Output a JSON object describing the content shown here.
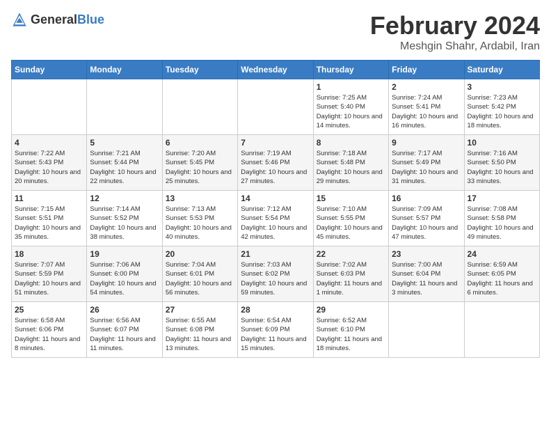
{
  "header": {
    "logo_general": "General",
    "logo_blue": "Blue",
    "title": "February 2024",
    "subtitle": "Meshgin Shahr, Ardabil, Iran"
  },
  "calendar": {
    "weekdays": [
      "Sunday",
      "Monday",
      "Tuesday",
      "Wednesday",
      "Thursday",
      "Friday",
      "Saturday"
    ],
    "weeks": [
      [
        {
          "day": "",
          "info": ""
        },
        {
          "day": "",
          "info": ""
        },
        {
          "day": "",
          "info": ""
        },
        {
          "day": "",
          "info": ""
        },
        {
          "day": "1",
          "info": "Sunrise: 7:25 AM\nSunset: 5:40 PM\nDaylight: 10 hours\nand 14 minutes."
        },
        {
          "day": "2",
          "info": "Sunrise: 7:24 AM\nSunset: 5:41 PM\nDaylight: 10 hours\nand 16 minutes."
        },
        {
          "day": "3",
          "info": "Sunrise: 7:23 AM\nSunset: 5:42 PM\nDaylight: 10 hours\nand 18 minutes."
        }
      ],
      [
        {
          "day": "4",
          "info": "Sunrise: 7:22 AM\nSunset: 5:43 PM\nDaylight: 10 hours\nand 20 minutes."
        },
        {
          "day": "5",
          "info": "Sunrise: 7:21 AM\nSunset: 5:44 PM\nDaylight: 10 hours\nand 22 minutes."
        },
        {
          "day": "6",
          "info": "Sunrise: 7:20 AM\nSunset: 5:45 PM\nDaylight: 10 hours\nand 25 minutes."
        },
        {
          "day": "7",
          "info": "Sunrise: 7:19 AM\nSunset: 5:46 PM\nDaylight: 10 hours\nand 27 minutes."
        },
        {
          "day": "8",
          "info": "Sunrise: 7:18 AM\nSunset: 5:48 PM\nDaylight: 10 hours\nand 29 minutes."
        },
        {
          "day": "9",
          "info": "Sunrise: 7:17 AM\nSunset: 5:49 PM\nDaylight: 10 hours\nand 31 minutes."
        },
        {
          "day": "10",
          "info": "Sunrise: 7:16 AM\nSunset: 5:50 PM\nDaylight: 10 hours\nand 33 minutes."
        }
      ],
      [
        {
          "day": "11",
          "info": "Sunrise: 7:15 AM\nSunset: 5:51 PM\nDaylight: 10 hours\nand 35 minutes."
        },
        {
          "day": "12",
          "info": "Sunrise: 7:14 AM\nSunset: 5:52 PM\nDaylight: 10 hours\nand 38 minutes."
        },
        {
          "day": "13",
          "info": "Sunrise: 7:13 AM\nSunset: 5:53 PM\nDaylight: 10 hours\nand 40 minutes."
        },
        {
          "day": "14",
          "info": "Sunrise: 7:12 AM\nSunset: 5:54 PM\nDaylight: 10 hours\nand 42 minutes."
        },
        {
          "day": "15",
          "info": "Sunrise: 7:10 AM\nSunset: 5:55 PM\nDaylight: 10 hours\nand 45 minutes."
        },
        {
          "day": "16",
          "info": "Sunrise: 7:09 AM\nSunset: 5:57 PM\nDaylight: 10 hours\nand 47 minutes."
        },
        {
          "day": "17",
          "info": "Sunrise: 7:08 AM\nSunset: 5:58 PM\nDaylight: 10 hours\nand 49 minutes."
        }
      ],
      [
        {
          "day": "18",
          "info": "Sunrise: 7:07 AM\nSunset: 5:59 PM\nDaylight: 10 hours\nand 51 minutes."
        },
        {
          "day": "19",
          "info": "Sunrise: 7:06 AM\nSunset: 6:00 PM\nDaylight: 10 hours\nand 54 minutes."
        },
        {
          "day": "20",
          "info": "Sunrise: 7:04 AM\nSunset: 6:01 PM\nDaylight: 10 hours\nand 56 minutes."
        },
        {
          "day": "21",
          "info": "Sunrise: 7:03 AM\nSunset: 6:02 PM\nDaylight: 10 hours\nand 59 minutes."
        },
        {
          "day": "22",
          "info": "Sunrise: 7:02 AM\nSunset: 6:03 PM\nDaylight: 11 hours\nand 1 minute."
        },
        {
          "day": "23",
          "info": "Sunrise: 7:00 AM\nSunset: 6:04 PM\nDaylight: 11 hours\nand 3 minutes."
        },
        {
          "day": "24",
          "info": "Sunrise: 6:59 AM\nSunset: 6:05 PM\nDaylight: 11 hours\nand 6 minutes."
        }
      ],
      [
        {
          "day": "25",
          "info": "Sunrise: 6:58 AM\nSunset: 6:06 PM\nDaylight: 11 hours\nand 8 minutes."
        },
        {
          "day": "26",
          "info": "Sunrise: 6:56 AM\nSunset: 6:07 PM\nDaylight: 11 hours\nand 11 minutes."
        },
        {
          "day": "27",
          "info": "Sunrise: 6:55 AM\nSunset: 6:08 PM\nDaylight: 11 hours\nand 13 minutes."
        },
        {
          "day": "28",
          "info": "Sunrise: 6:54 AM\nSunset: 6:09 PM\nDaylight: 11 hours\nand 15 minutes."
        },
        {
          "day": "29",
          "info": "Sunrise: 6:52 AM\nSunset: 6:10 PM\nDaylight: 11 hours\nand 18 minutes."
        },
        {
          "day": "",
          "info": ""
        },
        {
          "day": "",
          "info": ""
        }
      ]
    ]
  }
}
